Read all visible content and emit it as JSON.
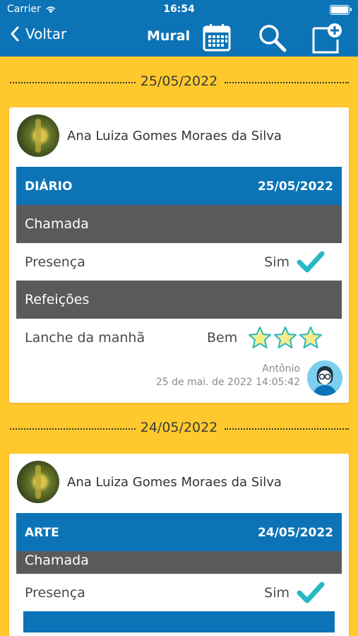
{
  "status_bar": {
    "carrier": "Carrier",
    "time": "16:54"
  },
  "nav": {
    "back_label": "Voltar",
    "title": "Mural"
  },
  "icons": {
    "back": "chevron-left-icon",
    "calendar": "calendar-icon",
    "search": "search-icon",
    "new_post": "new-post-icon"
  },
  "colors": {
    "background": "#FFC92E",
    "primary": "#0C74B6",
    "section_gray": "#5A5A5A",
    "check": "#27B8C4",
    "star": "#F6EC8A"
  },
  "feed": [
    {
      "date": "25/05/2022",
      "student": "Ana Luiza Gomes Moraes da Silva",
      "type_label": "DIÁRIO",
      "type_date": "25/05/2022",
      "attendance_section": "Chamada",
      "presence_label": "Presença",
      "presence_value": "Sim",
      "meals_section": "Refeições",
      "meal_label": "Lanche da manhã",
      "meal_value": "Bem",
      "meal_rating": 3,
      "meal_rating_max": 3,
      "author": "Antônio",
      "timestamp": "25 de mai. de 2022 14:05:42"
    },
    {
      "date": "24/05/2022",
      "student": "Ana Luiza Gomes Moraes da Silva",
      "type_label": "ARTE",
      "type_date": "24/05/2022",
      "attendance_section": "Chamada",
      "presence_label": "Presença",
      "presence_value": "Sim"
    }
  ]
}
